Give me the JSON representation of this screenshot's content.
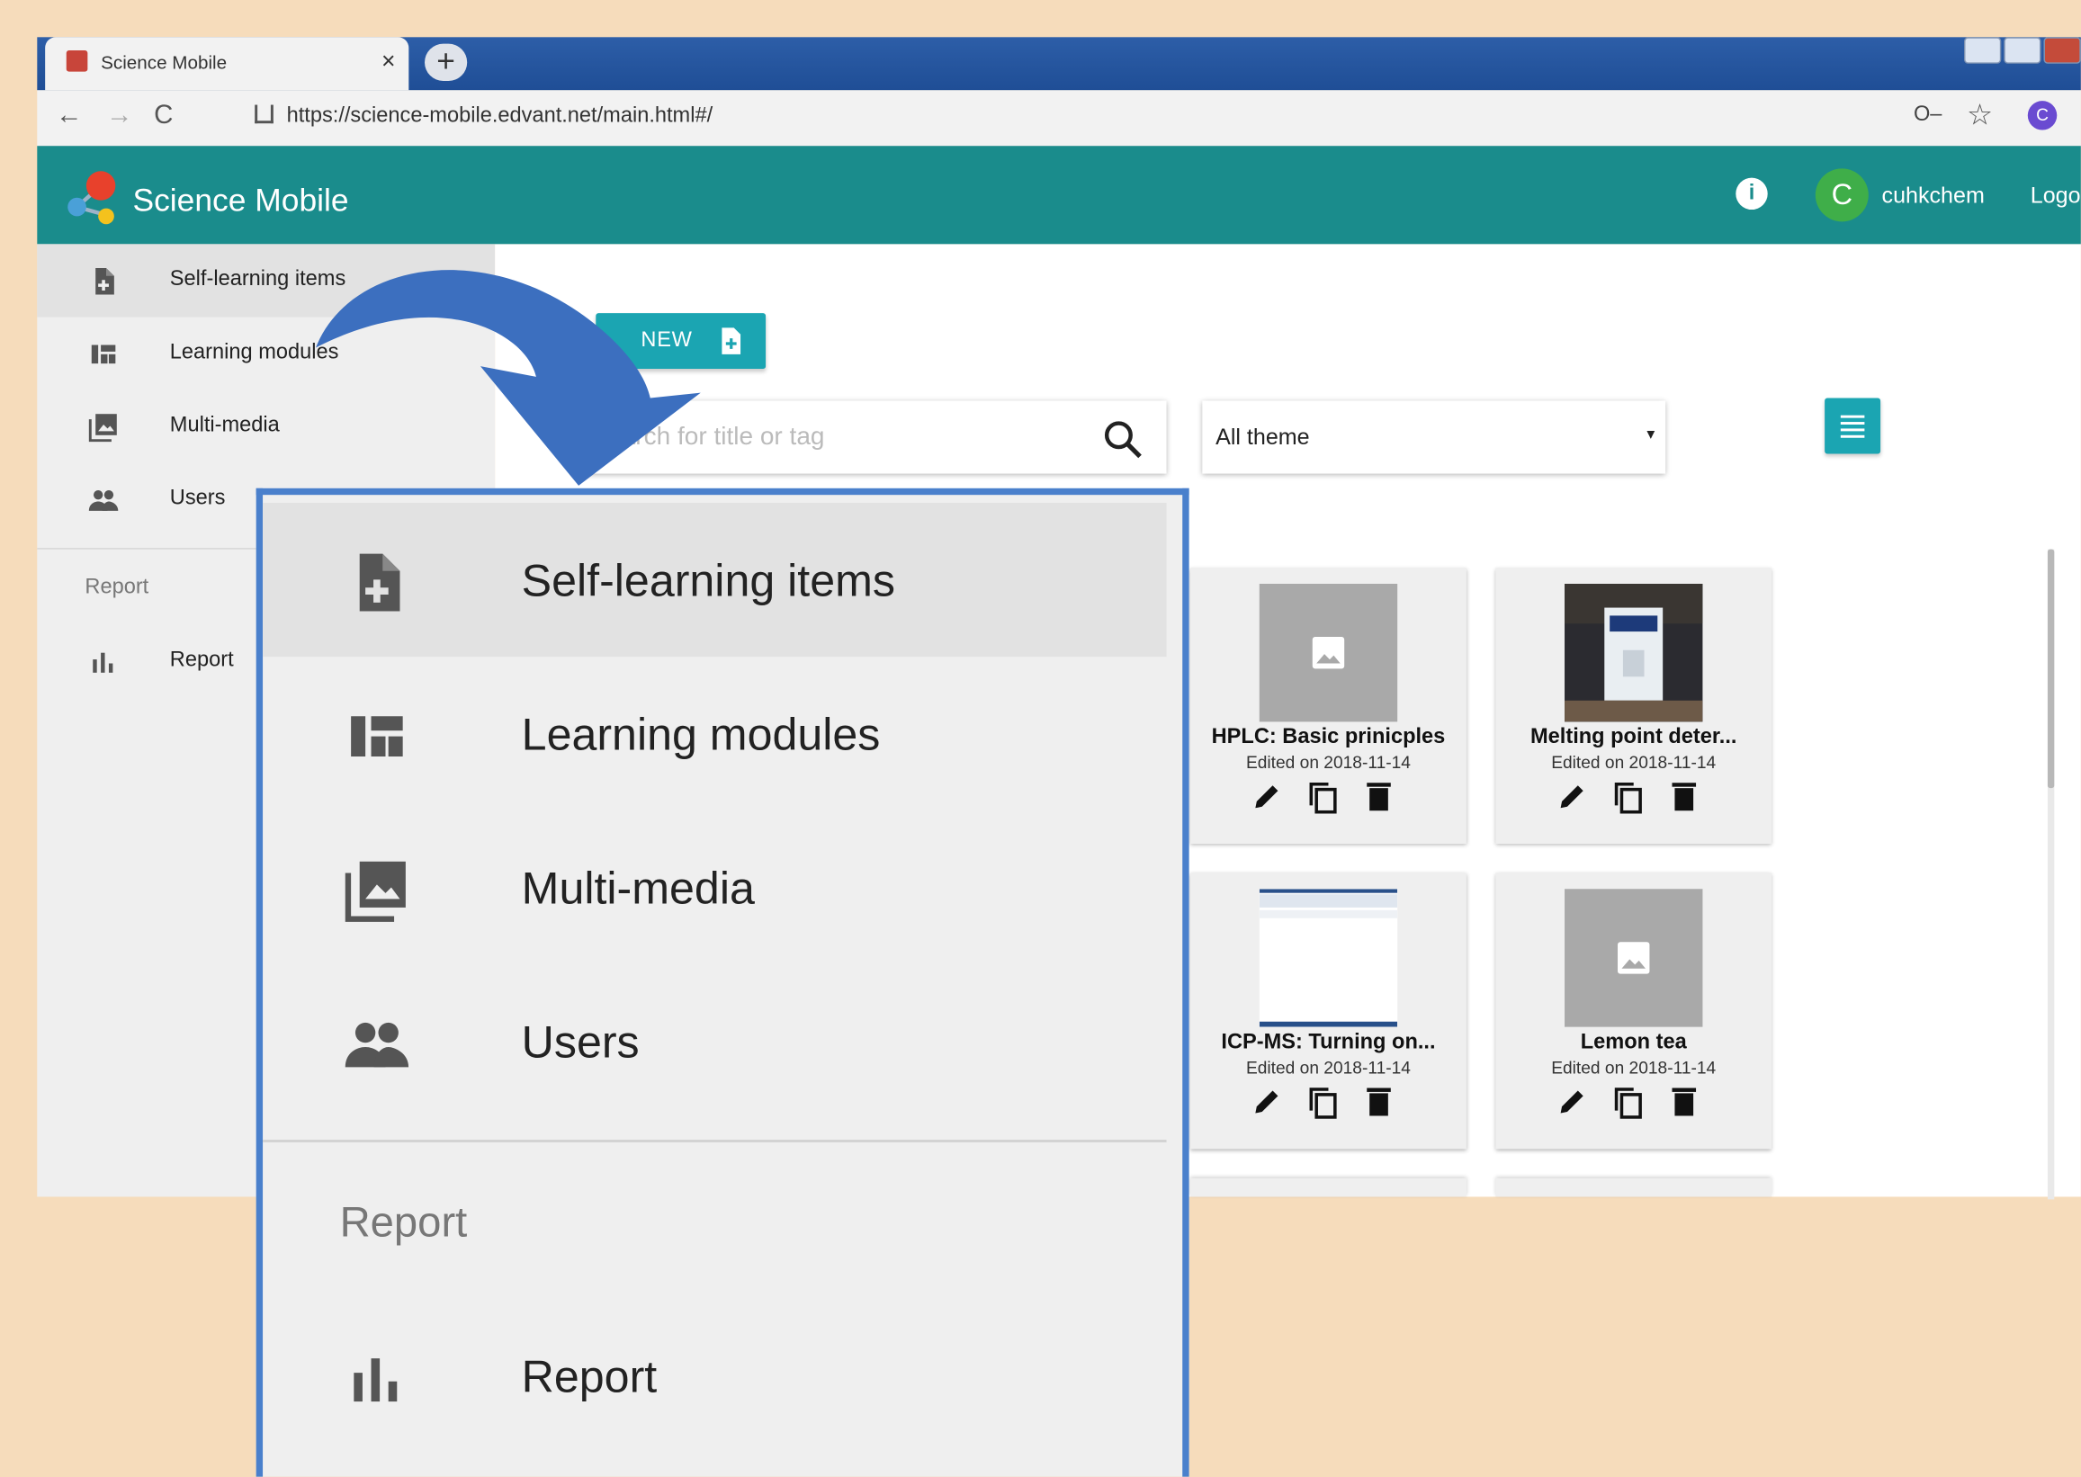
{
  "browser": {
    "tab_title": "Science Mobile",
    "tab_close": "×",
    "new_tab": "+",
    "url": "https://science-mobile.edvant.net/main.html#/",
    "profile_initial": "C"
  },
  "header": {
    "app_name": "Science Mobile",
    "user_initial": "C",
    "username": "cuhkchem",
    "logout": "Logo"
  },
  "sidebar": {
    "items": [
      {
        "label": "Self-learning items",
        "icon": "add-document-icon",
        "active": true
      },
      {
        "label": "Learning modules",
        "icon": "modules-icon"
      },
      {
        "label": "Multi-media",
        "icon": "photo-library-icon"
      },
      {
        "label": "Users",
        "icon": "people-icon"
      }
    ],
    "report_heading": "Report",
    "report_item": {
      "label": "Report",
      "icon": "bar-chart-icon"
    }
  },
  "toolbar": {
    "new_label": "NEW",
    "search_placeholder": "Search for title or tag",
    "theme_value": "All theme",
    "theme_arrow": "▾"
  },
  "cards": [
    {
      "title": "HPLC: Basic prinicples",
      "date": "Edited on 2018-11-14",
      "thumb": "placeholder"
    },
    {
      "title": "Melting point deter...",
      "date": "Edited on 2018-11-14",
      "thumb": "photo-instrument"
    },
    {
      "title": "ICP-MS: Turning on...",
      "date": "Edited on 2018-11-14",
      "thumb": "screenshot"
    },
    {
      "title": "Lemon tea",
      "date": "Edited on 2018-11-14",
      "thumb": "placeholder"
    }
  ],
  "zoom_menu": {
    "items": [
      {
        "label": "Self-learning items"
      },
      {
        "label": "Learning modules"
      },
      {
        "label": "Multi-media"
      },
      {
        "label": "Users"
      }
    ],
    "report_heading": "Report",
    "report_item": "Report"
  },
  "colors": {
    "background": "#f6dcbb",
    "header_teal": "#1a8c8c",
    "button_teal": "#1ba5b2",
    "highlight_border": "#4a80cc",
    "arrow": "#3c6fbf"
  }
}
